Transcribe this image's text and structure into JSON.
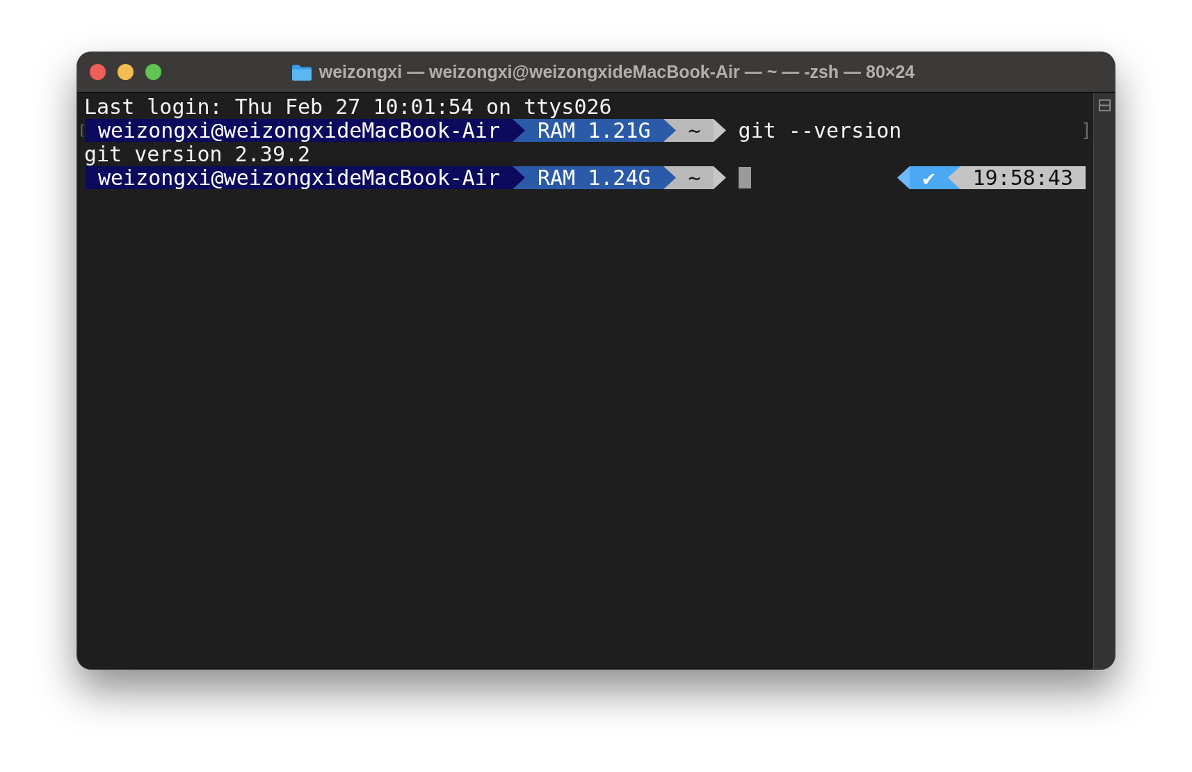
{
  "window": {
    "title": "weizongxi — weizongxi@weizongxideMacBook-Air — ~ — -zsh — 80×24"
  },
  "lines": [
    {
      "kind": "text",
      "text": "Last login: Thu Feb 27 10:01:54 on ttys026"
    },
    {
      "kind": "prompt",
      "bracket_open": "[",
      "bracket_close": "]",
      "segments": [
        {
          "text": "weizongxi@weizongxideMacBook-Air",
          "color": "#0b0a5c"
        },
        {
          "text": "RAM 1.21G",
          "color": "#2b5aa8"
        },
        {
          "text": "~",
          "color": "#b9b9b9"
        }
      ],
      "command": "git --version",
      "cursor": false
    },
    {
      "kind": "text",
      "text": "git version 2.39.2"
    },
    {
      "kind": "prompt",
      "segments": [
        {
          "text": "weizongxi@weizongxideMacBook-Air",
          "color": "#0b0a5c"
        },
        {
          "text": "RAM 1.24G",
          "color": "#2b5aa8"
        },
        {
          "text": "~",
          "color": "#b9b9b9"
        }
      ],
      "cursor": true,
      "right_segments": [
        {
          "text": "✔",
          "color": "#4aa8f5"
        },
        {
          "text": "19:58:43",
          "color": "#c4c4c4"
        }
      ]
    }
  ]
}
